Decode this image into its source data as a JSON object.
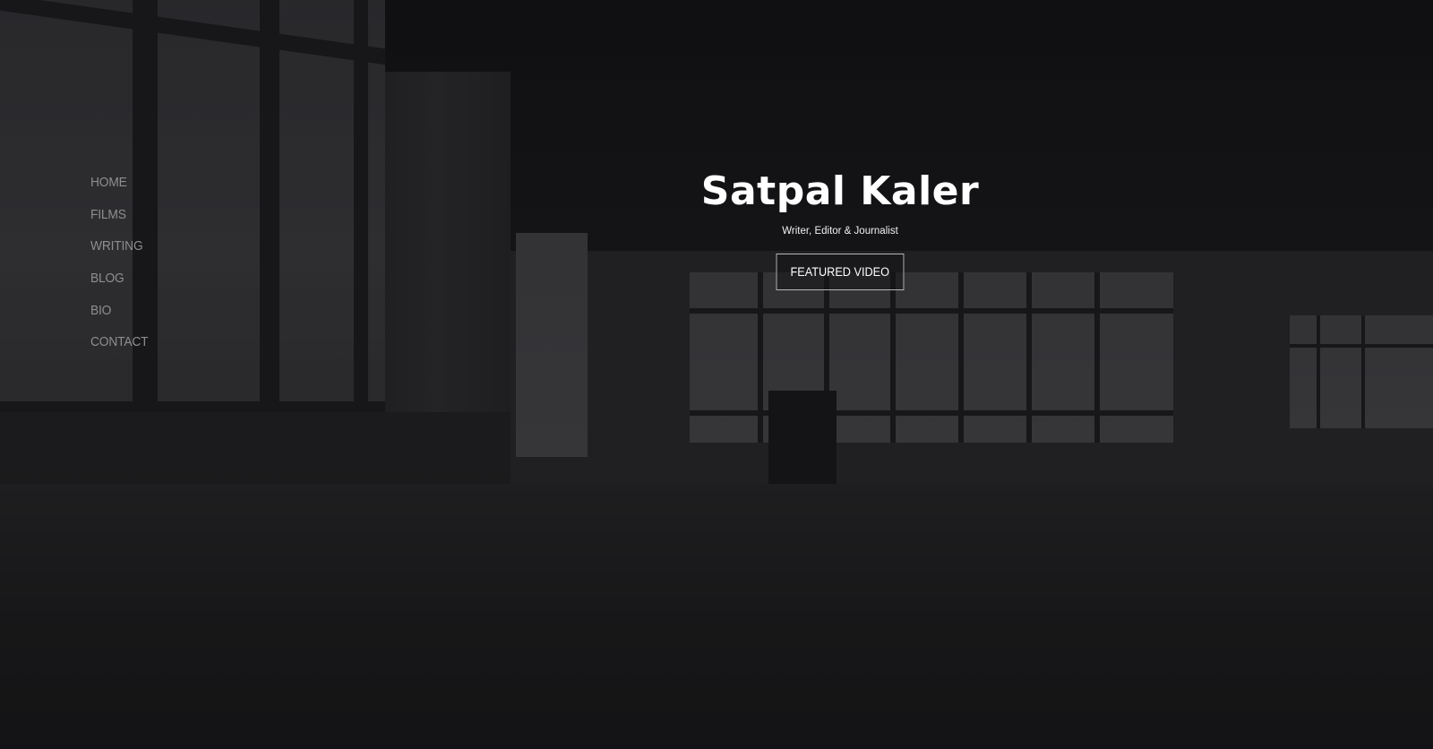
{
  "nav": {
    "items": [
      {
        "label": "HOME"
      },
      {
        "label": "FILMS"
      },
      {
        "label": "WRITING"
      },
      {
        "label": "BLOG"
      },
      {
        "label": "BIO"
      },
      {
        "label": "CONTACT"
      }
    ]
  },
  "hero": {
    "title": "Satpal Kaler",
    "subtitle": "Writer, Editor & Journalist",
    "cta_label": "FEATURED VIDEO"
  },
  "colors": {
    "background": "#1b1b1c",
    "nav_text": "#8e8e90",
    "title_text": "#ffffff",
    "button_border": "#b8b8b8"
  }
}
